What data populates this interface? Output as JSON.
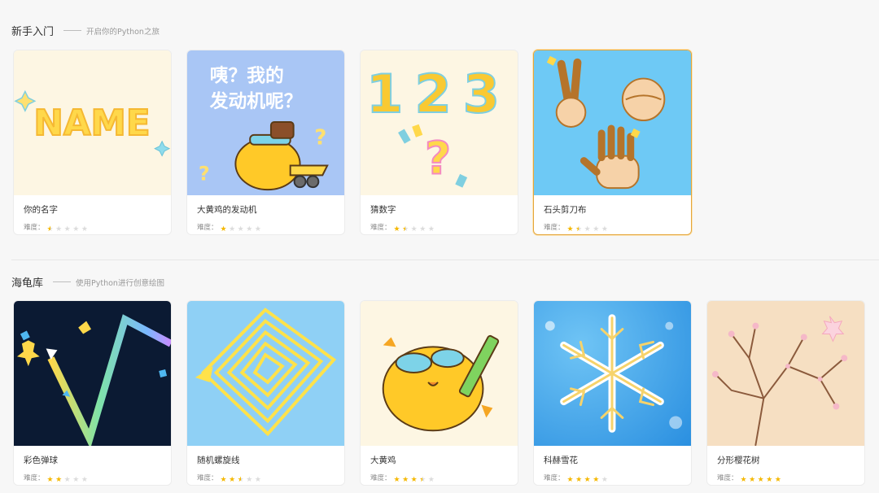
{
  "sections": [
    {
      "title": "新手入门",
      "subtitle": "开启你的Python之旅"
    },
    {
      "title": "海龟库",
      "subtitle": "使用Python进行创意绘图"
    }
  ],
  "difficulty_label": "难度：",
  "cards": [
    {
      "name": "你的名字",
      "difficulty": 0.5,
      "thumb_text": "NAME"
    },
    {
      "name": "大黄鸡的发动机",
      "difficulty": 1,
      "thumb_text_line1": "咦？我的",
      "thumb_text_line2": "发动机呢？"
    },
    {
      "name": "猜数字",
      "difficulty": 1.5,
      "thumb_text": "123"
    },
    {
      "name": "石头剪刀布",
      "difficulty": 1.5,
      "selected": true
    },
    {
      "name": "彩色弹球",
      "difficulty": 2
    },
    {
      "name": "随机螺旋线",
      "difficulty": 2.5
    },
    {
      "name": "大黄鸡",
      "difficulty": 3.5
    },
    {
      "name": "科赫雪花",
      "difficulty": 4
    },
    {
      "name": "分形樱花树",
      "difficulty": 5
    }
  ],
  "colors": {
    "accent": "#e4a63a",
    "star": "#f5b800",
    "star_empty": "#dcdcdc"
  }
}
